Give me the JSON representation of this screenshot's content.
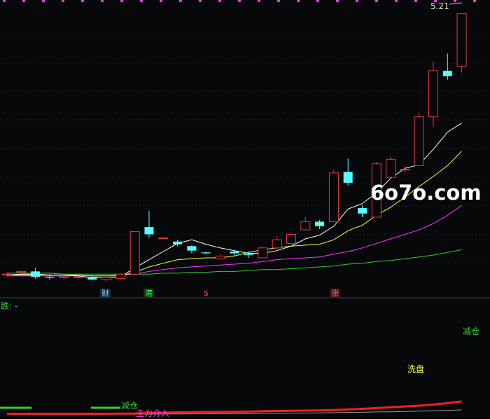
{
  "price_label": "5.21",
  "watermark": "6o7o.com",
  "lower_indicator_prefix": "跌: -",
  "markers": {
    "cai": "财",
    "gang": "港",
    "dollar": "$",
    "zhang": "涨"
  },
  "signals": {
    "jiancang_top": "减仓",
    "xipan": "洗盘",
    "jiancang_bottom": "减仓",
    "zhuli": "主力介入"
  },
  "colors": {
    "up": "#e8383d",
    "down": "#54ffff",
    "ma5": "#ffffff",
    "ma10": "#ffff33",
    "ma20": "#ff33ff",
    "ma60": "#33cc33",
    "grid": "#2a2f3a",
    "magenta_ticks": "#ff33ff"
  },
  "chart_data": {
    "type": "candlestick",
    "ohlc": [
      {
        "o": 2.33,
        "h": 2.35,
        "l": 2.3,
        "c": 2.33
      },
      {
        "o": 2.35,
        "h": 2.37,
        "l": 2.33,
        "c": 2.36
      },
      {
        "o": 2.36,
        "h": 2.4,
        "l": 2.28,
        "c": 2.3
      },
      {
        "o": 2.3,
        "h": 2.33,
        "l": 2.27,
        "c": 2.29
      },
      {
        "o": 2.29,
        "h": 2.33,
        "l": 2.27,
        "c": 2.3
      },
      {
        "o": 2.29,
        "h": 2.32,
        "l": 2.27,
        "c": 2.3
      },
      {
        "o": 2.3,
        "h": 2.31,
        "l": 2.26,
        "c": 2.27
      },
      {
        "o": 2.27,
        "h": 2.31,
        "l": 2.25,
        "c": 2.29
      },
      {
        "o": 2.28,
        "h": 2.34,
        "l": 2.27,
        "c": 2.33
      },
      {
        "o": 2.33,
        "h": 2.8,
        "l": 2.33,
        "c": 2.8
      },
      {
        "o": 2.85,
        "h": 3.03,
        "l": 2.73,
        "c": 2.77
      },
      {
        "o": 2.73,
        "h": 2.7,
        "l": 2.7,
        "c": 2.73
      },
      {
        "o": 2.69,
        "h": 2.71,
        "l": 2.64,
        "c": 2.66
      },
      {
        "o": 2.64,
        "h": 2.65,
        "l": 2.56,
        "c": 2.59
      },
      {
        "o": 2.57,
        "h": 2.58,
        "l": 2.55,
        "c": 2.56
      },
      {
        "o": 2.5,
        "h": 2.55,
        "l": 2.49,
        "c": 2.53
      },
      {
        "o": 2.58,
        "h": 2.6,
        "l": 2.53,
        "c": 2.56
      },
      {
        "o": 2.55,
        "h": 2.58,
        "l": 2.51,
        "c": 2.54
      },
      {
        "o": 2.51,
        "h": 2.63,
        "l": 2.51,
        "c": 2.62
      },
      {
        "o": 2.62,
        "h": 2.75,
        "l": 2.61,
        "c": 2.71
      },
      {
        "o": 2.67,
        "h": 2.78,
        "l": 2.67,
        "c": 2.77
      },
      {
        "o": 2.82,
        "h": 2.96,
        "l": 2.82,
        "c": 2.91
      },
      {
        "o": 2.91,
        "h": 2.93,
        "l": 2.83,
        "c": 2.86
      },
      {
        "o": 2.91,
        "h": 3.49,
        "l": 2.91,
        "c": 3.45
      },
      {
        "o": 3.46,
        "h": 3.61,
        "l": 3.31,
        "c": 3.34
      },
      {
        "o": 3.06,
        "h": 3.09,
        "l": 2.96,
        "c": 3.0
      },
      {
        "o": 2.96,
        "h": 3.57,
        "l": 2.96,
        "c": 3.55
      },
      {
        "o": 3.4,
        "h": 3.63,
        "l": 3.38,
        "c": 3.6
      },
      {
        "o": 3.49,
        "h": 3.53,
        "l": 3.45,
        "c": 3.49
      },
      {
        "o": 3.53,
        "h": 4.12,
        "l": 3.53,
        "c": 4.07
      },
      {
        "o": 4.07,
        "h": 4.68,
        "l": 3.96,
        "c": 4.58
      },
      {
        "o": 4.58,
        "h": 4.77,
        "l": 4.48,
        "c": 4.52
      },
      {
        "o": 4.63,
        "h": 5.21,
        "l": 4.56,
        "c": 5.21
      }
    ],
    "ma5": [
      2.32,
      2.33,
      2.33,
      2.32,
      2.32,
      2.31,
      2.29,
      2.29,
      2.3,
      2.4,
      2.49,
      2.58,
      2.67,
      2.71,
      2.66,
      2.62,
      2.59,
      2.56,
      2.56,
      2.59,
      2.64,
      2.72,
      2.76,
      2.86,
      3.05,
      3.11,
      3.23,
      3.39,
      3.5,
      3.54,
      3.71,
      3.9,
      4.0
    ],
    "ma10": [
      2.32,
      2.32,
      2.32,
      2.32,
      2.32,
      2.32,
      2.31,
      2.31,
      2.31,
      2.35,
      2.41,
      2.45,
      2.49,
      2.5,
      2.51,
      2.51,
      2.53,
      2.57,
      2.6,
      2.62,
      2.64,
      2.65,
      2.66,
      2.71,
      2.81,
      2.87,
      2.98,
      3.07,
      3.18,
      3.3,
      3.41,
      3.53,
      3.69
    ],
    "ma20": [
      2.31,
      2.31,
      2.31,
      2.31,
      2.31,
      2.31,
      2.31,
      2.31,
      2.32,
      2.33,
      2.36,
      2.38,
      2.4,
      2.41,
      2.42,
      2.43,
      2.44,
      2.45,
      2.47,
      2.49,
      2.5,
      2.51,
      2.52,
      2.55,
      2.58,
      2.62,
      2.67,
      2.72,
      2.77,
      2.82,
      2.89,
      2.98,
      3.09
    ],
    "ma60": [
      2.34,
      2.34,
      2.34,
      2.34,
      2.33,
      2.33,
      2.33,
      2.33,
      2.33,
      2.33,
      2.33,
      2.34,
      2.34,
      2.35,
      2.35,
      2.36,
      2.36,
      2.37,
      2.38,
      2.38,
      2.39,
      2.4,
      2.41,
      2.42,
      2.44,
      2.45,
      2.47,
      2.48,
      2.5,
      2.52,
      2.54,
      2.57,
      2.6
    ],
    "ylim": [
      2.2,
      5.3
    ],
    "grid": true
  }
}
